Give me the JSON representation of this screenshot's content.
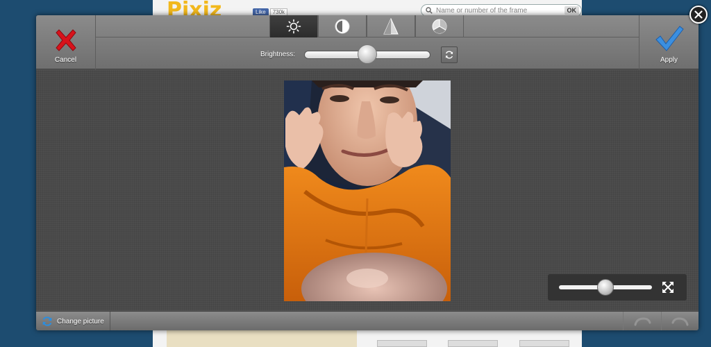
{
  "background": {
    "logo_text": "Pixiz",
    "like_label": "Like",
    "like_count": "730k",
    "search_placeholder": "Name or number of the frame",
    "search_ok": "OK"
  },
  "editor": {
    "cancel_label": "Cancel",
    "apply_label": "Apply",
    "tabs": [
      {
        "icon": "brightness-icon",
        "active": true
      },
      {
        "icon": "contrast-icon",
        "active": false
      },
      {
        "icon": "sharpness-icon",
        "active": false
      },
      {
        "icon": "saturation-icon",
        "active": false
      }
    ],
    "slider_label": "Brightness:",
    "brightness_value": 0.5,
    "zoom_value": 0.5,
    "change_picture_label": "Change picture",
    "colors": {
      "cancel_x": "#d8121b",
      "apply_check": "#3b8fe0",
      "toolbar": "#7c7c7c",
      "canvas": "#4a4a4a",
      "page_background": "#1d4c70"
    }
  }
}
